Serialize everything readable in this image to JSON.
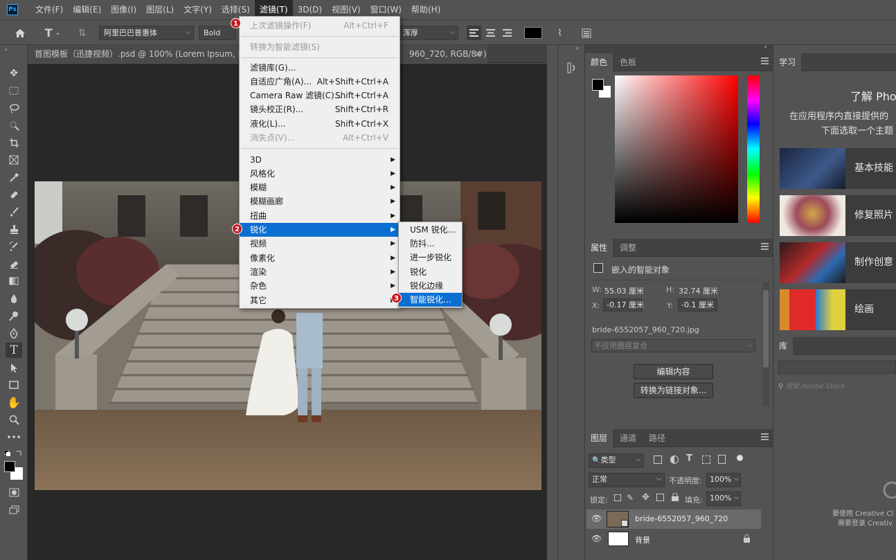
{
  "app": {
    "logo": "Ps"
  },
  "menubar": {
    "items": [
      "文件(F)",
      "编辑(E)",
      "图像(I)",
      "图层(L)",
      "文字(Y)",
      "选择(S)",
      "滤镜(T)",
      "3D(D)",
      "视图(V)",
      "窗口(W)",
      "帮助(H)"
    ],
    "active_index": 6
  },
  "options_bar": {
    "font_family": "阿里巴巴普惠体",
    "font_style": "Bold",
    "antialias": "浑厚",
    "home_icon": "home-icon",
    "type_icon": "type-tool-icon"
  },
  "document_tab": {
    "title_left": "首图模板（迅捷视频）.psd @ 100% (Lorem Ipsum, RGB/",
    "title_right": "960_720, RGB/8#) *",
    "close": "×"
  },
  "filter_menu": {
    "items": [
      {
        "label": "上次滤镜操作(F)",
        "shortcut": "Alt+Ctrl+F",
        "disabled": true
      },
      {
        "label": "转换为智能滤镜(S)",
        "shortcut": "",
        "disabled": true
      },
      {
        "label": "滤镜库(G)...",
        "shortcut": ""
      },
      {
        "label": "自适应广角(A)...",
        "shortcut": "Alt+Shift+Ctrl+A"
      },
      {
        "label": "Camera Raw 滤镜(C)...",
        "shortcut": "Shift+Ctrl+A"
      },
      {
        "label": "镜头校正(R)...",
        "shortcut": "Shift+Ctrl+R"
      },
      {
        "label": "液化(L)...",
        "shortcut": "Shift+Ctrl+X"
      },
      {
        "label": "消失点(V)...",
        "shortcut": "Alt+Ctrl+V",
        "disabled": true
      },
      {
        "label": "3D",
        "submenu": true
      },
      {
        "label": "风格化",
        "submenu": true
      },
      {
        "label": "模糊",
        "submenu": true
      },
      {
        "label": "模糊画廊",
        "submenu": true
      },
      {
        "label": "扭曲",
        "submenu": true
      },
      {
        "label": "锐化",
        "submenu": true,
        "highlighted": true
      },
      {
        "label": "视频",
        "submenu": true
      },
      {
        "label": "像素化",
        "submenu": true
      },
      {
        "label": "渲染",
        "submenu": true
      },
      {
        "label": "杂色",
        "submenu": true
      },
      {
        "label": "其它",
        "submenu": true
      }
    ]
  },
  "sharpen_submenu": {
    "items": [
      {
        "label": "USM 锐化..."
      },
      {
        "label": "防抖..."
      },
      {
        "label": "进一步锐化"
      },
      {
        "label": "锐化"
      },
      {
        "label": "锐化边缘"
      },
      {
        "label": "智能锐化...",
        "highlighted": true
      }
    ]
  },
  "badges": [
    "1",
    "2",
    "3"
  ],
  "color_panel": {
    "tabs": [
      "颜色",
      "色板"
    ],
    "hue_strip": "hue-slider"
  },
  "properties_panel": {
    "tabs": [
      "属性",
      "调整"
    ],
    "type_label": "嵌入的智能对象",
    "w_label": "W:",
    "w_value": "55.03 厘米",
    "h_label": "H:",
    "h_value": "32.74 厘米",
    "x_label": "X:",
    "x_value": "-0.17 厘米",
    "y_label": "Y:",
    "y_value": "-0.1 厘米",
    "filename": "bride-6552057_960_720.jpg",
    "comp_select": "不应用图层复合",
    "edit_button": "编辑内容",
    "convert_button": "转换为链接对象..."
  },
  "layers_panel": {
    "tabs": [
      "图层",
      "通道",
      "路径"
    ],
    "filter_kind": "类型",
    "blend_mode": "正常",
    "opacity_label": "不透明度:",
    "opacity_value": "100%",
    "lock_label": "锁定:",
    "fill_label": "填充:",
    "fill_value": "100%",
    "layers": [
      {
        "name": "bride-6552057_960_720",
        "selected": true
      },
      {
        "name": "背景",
        "locked": true
      }
    ]
  },
  "learn_panel": {
    "tab": "学习",
    "heading": "了解 Photo",
    "desc1": "在应用程序内直接提供的",
    "desc2": "下面选取一个主题",
    "cards": [
      "基本技能",
      "修复照片",
      "制作创意",
      "绘画"
    ]
  },
  "library_panel": {
    "tab": "库",
    "search_placeholder": "搜索 Adobe Stock",
    "note1": "要使用 Creative Cl",
    "note2": "需要登录 Creativ"
  },
  "colors": {
    "menu_highlight": "#0b6fd1",
    "badge": "#c8161e"
  }
}
